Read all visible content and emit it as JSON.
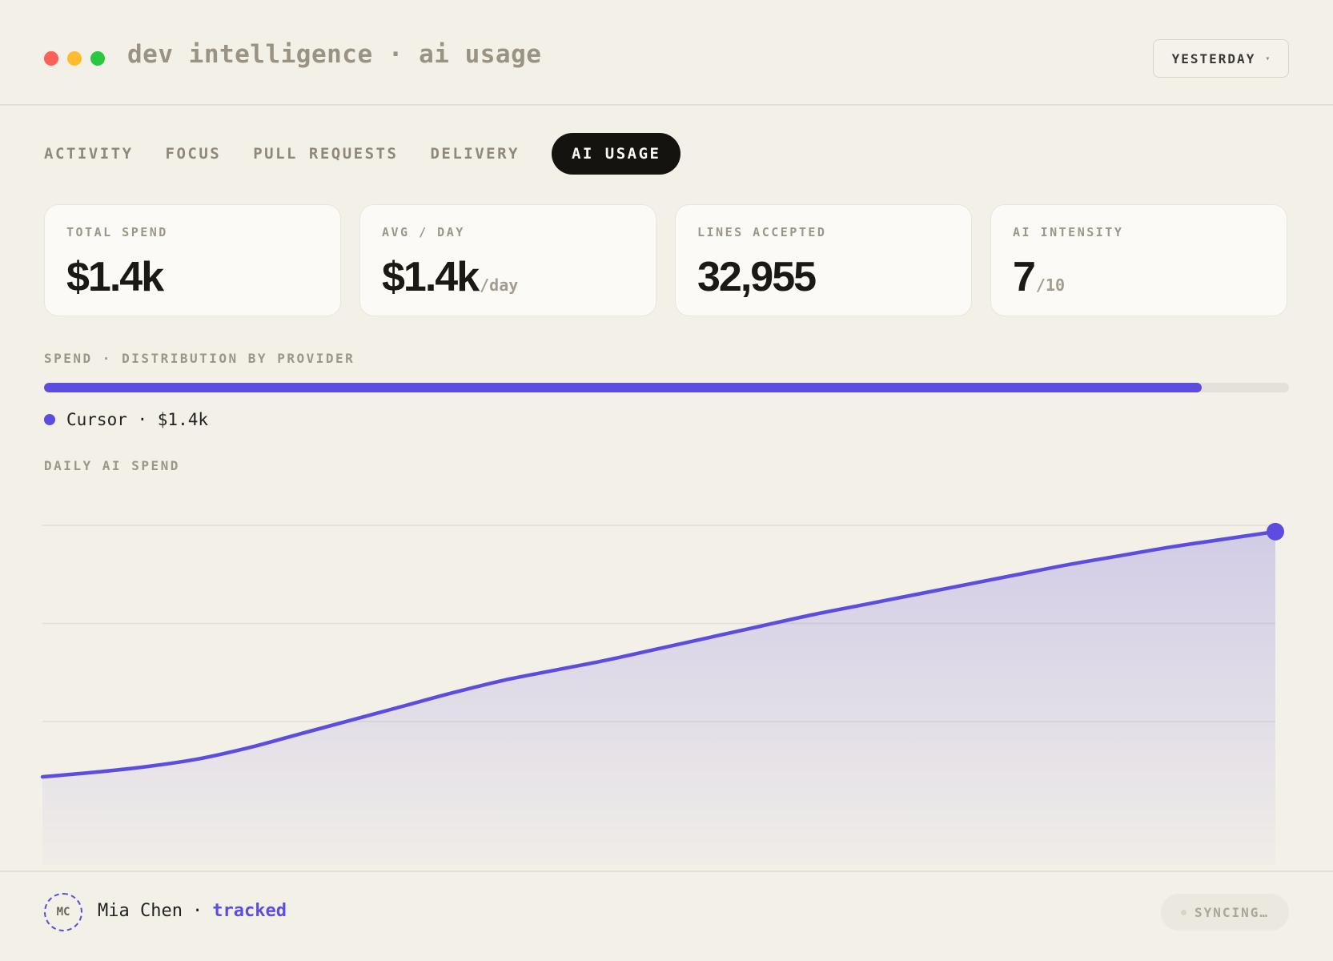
{
  "window": {
    "title": "dev intelligence · ai usage",
    "controls": [
      {
        "name": "close",
        "color": "#fe5f57"
      },
      {
        "name": "minimize",
        "color": "#febc2e"
      },
      {
        "name": "maximize",
        "color": "#28c840"
      }
    ]
  },
  "range": {
    "label": "YESTERDAY",
    "caret": "▾"
  },
  "tabs": [
    {
      "label": "ACTIVITY",
      "active": false
    },
    {
      "label": "FOCUS",
      "active": false
    },
    {
      "label": "PULL REQUESTS",
      "active": false
    },
    {
      "label": "DELIVERY",
      "active": false
    },
    {
      "label": "AI USAGE",
      "active": true
    }
  ],
  "kpis": [
    {
      "label": "TOTAL SPEND",
      "value": "$1.4k",
      "unit": ""
    },
    {
      "label": "AVG / DAY",
      "value": "$1.4k",
      "unit": "/day"
    },
    {
      "label": "LINES ACCEPTED",
      "value": "32,955",
      "unit": ""
    },
    {
      "label": "AI INTENSITY",
      "value": "7",
      "unit": "/10"
    }
  ],
  "distribution": {
    "label": "SPEND · DISTRIBUTION BY PROVIDER",
    "providers": [
      {
        "name": "Cursor",
        "legend": "Cursor · $1.4k",
        "share": 0.93,
        "color": "#5a4de0"
      }
    ]
  },
  "daily": {
    "label": "DAILY AI SPEND"
  },
  "chart_data": {
    "type": "area",
    "title": "DAILY AI SPEND",
    "x": [
      0,
      1,
      2,
      3,
      4,
      5,
      6,
      7,
      8,
      9,
      10,
      11,
      12,
      13,
      14,
      15,
      16,
      17,
      18,
      19,
      20,
      21,
      22,
      23,
      24
    ],
    "values": [
      0,
      1.8,
      4,
      7,
      11.5,
      17,
      22.5,
      28,
      33.5,
      38.5,
      42.5,
      46.5,
      51,
      55.5,
      60,
      64.5,
      68.5,
      72.5,
      76.5,
      80.5,
      84.5,
      88,
      91.5,
      94.5,
      97.5
    ],
    "ylim": [
      -35,
      100
    ],
    "color": "#5a4de0",
    "grid": true,
    "gridlines": [
      100,
      61,
      22
    ],
    "highlight_last": true
  },
  "footer": {
    "initials": "MC",
    "name": "Mia Chen",
    "separator": "·",
    "status": "tracked",
    "sync_label": "SYNCING…"
  }
}
